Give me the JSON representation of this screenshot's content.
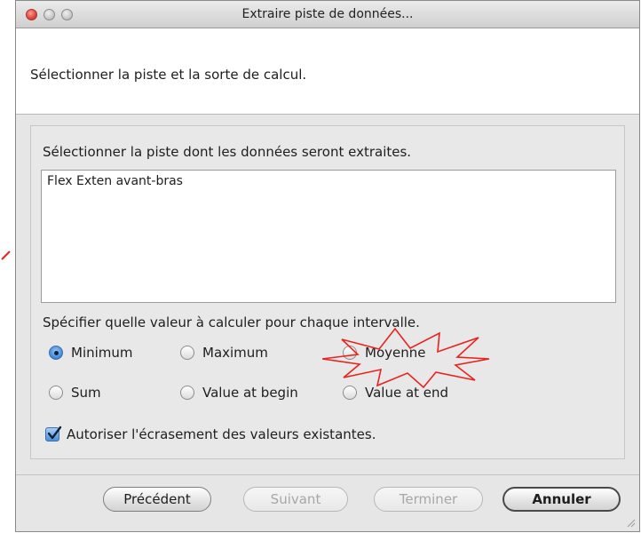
{
  "window": {
    "title": "Extraire piste de données..."
  },
  "header": {
    "instruction": "Sélectionner la piste et la sorte de calcul."
  },
  "track_section": {
    "label": "Sélectionner la piste dont les données seront extraites.",
    "items": [
      "Flex Exten avant-bras"
    ]
  },
  "calc_section": {
    "label": "Spécifier quelle valeur à calculer pour chaque intervalle.",
    "options": [
      {
        "label": "Minimum",
        "selected": true
      },
      {
        "label": "Maximum",
        "selected": false
      },
      {
        "label": "Moyenne",
        "selected": false
      },
      {
        "label": "Sum",
        "selected": false
      },
      {
        "label": "Value at begin",
        "selected": false
      },
      {
        "label": "Value at end",
        "selected": false
      }
    ]
  },
  "overwrite": {
    "label": "Autoriser l'écrasement des valeurs existantes.",
    "checked": true
  },
  "buttons": {
    "previous": "Précédent",
    "next": "Suivant",
    "finish": "Terminer",
    "cancel": "Annuler"
  },
  "colors": {
    "starburst": "#e8231e",
    "selection": "#3e86d6"
  }
}
